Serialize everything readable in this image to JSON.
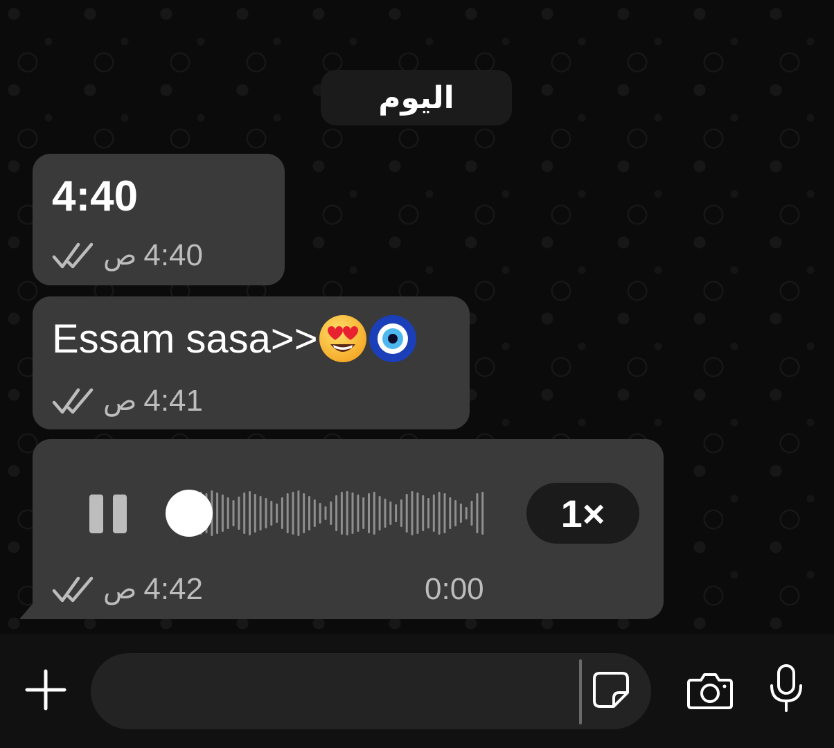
{
  "date_chip": "اليوم",
  "messages": [
    {
      "text": "4:40",
      "time": "4:40",
      "ampm": "ص",
      "status_icon": "double-check-icon"
    },
    {
      "text": "Essam sasa>>",
      "emojis": [
        "heart-eyes-emoji",
        "nazar-amulet-emoji"
      ],
      "time": "4:41",
      "ampm": "ص",
      "status_icon": "double-check-icon"
    },
    {
      "type": "voice",
      "duration": "0:00",
      "speed": "1×",
      "playback_state": "pause-icon",
      "progress": 0.0,
      "time": "4:42",
      "ampm": "ص",
      "status_icon": "double-check-icon"
    }
  ],
  "composer": {
    "icons": [
      "plus-icon",
      "sticker-icon",
      "camera-icon",
      "mic-icon"
    ],
    "input_value": ""
  },
  "colors": {
    "background": "#0b0b0b",
    "bubble": "#3a3a3a",
    "chip": "#1b1b1b",
    "meta_text": "#bdbdbd",
    "composer_bg": "#111111",
    "input_bg": "#232323"
  }
}
